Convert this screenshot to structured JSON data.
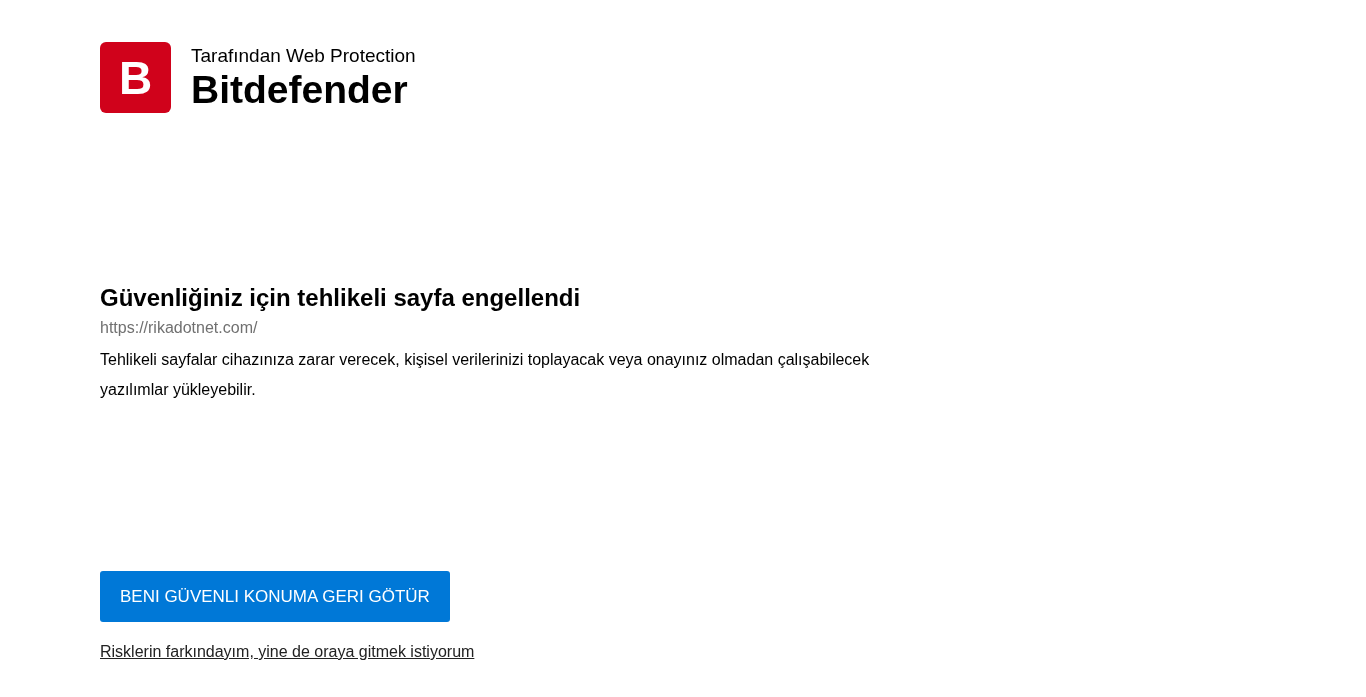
{
  "brand": {
    "logo_letter": "B",
    "subtitle": "Tarafından Web Protection",
    "name": "Bitdefender"
  },
  "warning": {
    "heading": "Güvenliğiniz için tehlikeli sayfa engellendi",
    "url": "https://rikadotnet.com/",
    "description": "Tehlikeli sayfalar cihazınıza zarar verecek, kişisel verilerinizi toplayacak veya onayınız olmadan çalışabilecek yazılımlar yükleyebilir."
  },
  "actions": {
    "primary_button": "BENI GÜVENLI KONUMA GERI GÖTÜR",
    "proceed_link": "Risklerin farkındayım, yine de oraya gitmek istiyorum"
  }
}
